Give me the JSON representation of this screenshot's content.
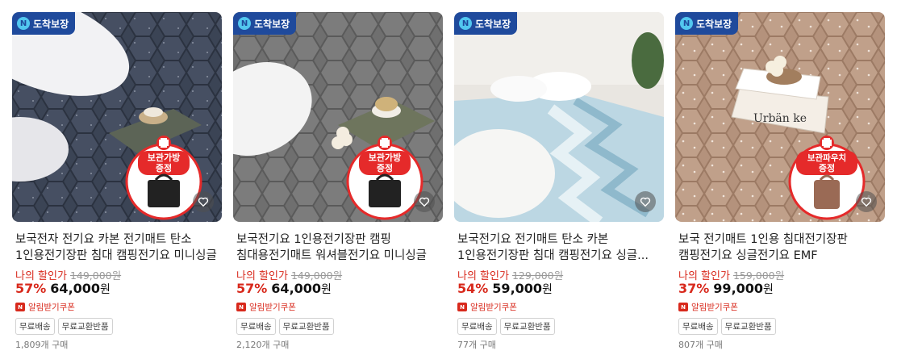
{
  "badge_label": "도착보장",
  "badge_icon": "N",
  "coupon_icon": "N",
  "products": [
    {
      "title_line1": "보국전자 전기요 카본 전기매트 탄소",
      "title_line2": "1인용전기장판 침대 캠핑전기요 미니싱글",
      "discount_label": "나의 할인가",
      "original_price": "149,000원",
      "discount_pct": "57%",
      "price": "64,000",
      "price_unit": "원",
      "coupon": "알림받기쿠폰",
      "tags": [
        "무료배송",
        "무료교환반품"
      ],
      "sold": "1,809개 구매",
      "gift_text": [
        "보관가방",
        "증정"
      ],
      "mat_color": "#3b4455",
      "mat_light": "#525c70"
    },
    {
      "title_line1": "보국전기요 1인용전기장판 캠핑",
      "title_line2": "침대용전기매트 워셔블전기요 미니싱글",
      "discount_label": "나의 할인가",
      "original_price": "149,000원",
      "discount_pct": "57%",
      "price": "64,000",
      "price_unit": "원",
      "coupon": "알림받기쿠폰",
      "tags": [
        "무료배송",
        "무료교환반품"
      ],
      "sold": "2,120개 구매",
      "gift_text": [
        "보관가방",
        "증정"
      ],
      "mat_color": "#6f6f6f",
      "mat_light": "#8a8a8a"
    },
    {
      "title_line1": "보국전기요 전기매트 탄소 카본",
      "title_line2": "1인용전기장판 침대 캠핑전기요 싱글...",
      "discount_label": "나의 할인가",
      "original_price": "129,000원",
      "discount_pct": "54%",
      "price": "59,000",
      "price_unit": "원",
      "coupon": "알림받기쿠폰",
      "tags": [
        "무료배송",
        "무료교환반품"
      ],
      "sold": "77개 구매",
      "gift_text": [],
      "mat_color": "#a9cbd9",
      "mat_light": "#e6eef2"
    },
    {
      "title_line1": "보국 전기매트 1인용 침대전기장판",
      "title_line2": "캠핑전기요 싱글전기요 EMF",
      "discount_label": "나의 할인가",
      "original_price": "159,000원",
      "discount_pct": "37%",
      "price": "99,000",
      "price_unit": "원",
      "coupon": "알림받기쿠폰",
      "tags": [
        "무료배송",
        "무료교환반품"
      ],
      "sold": "807개 구매",
      "gift_text": [
        "보관파우치",
        "증정"
      ],
      "mat_color": "#b4927c",
      "mat_light": "#c9aa94"
    }
  ],
  "book_text": "Urbän ke"
}
